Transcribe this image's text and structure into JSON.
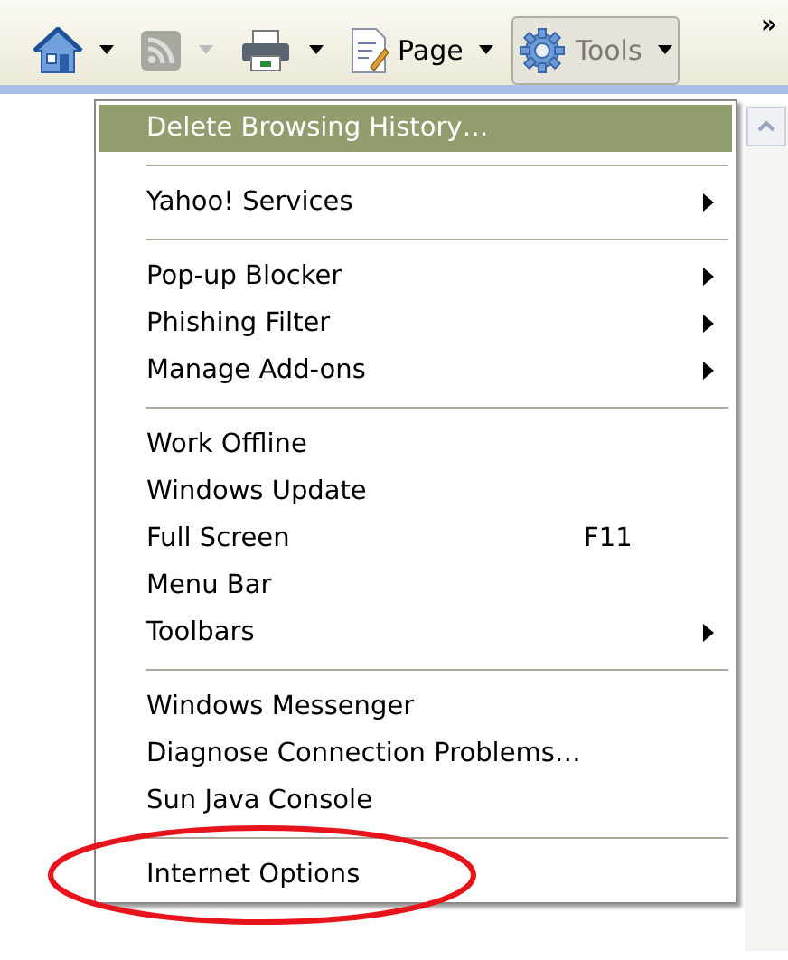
{
  "toolbar": {
    "buttons": [
      {
        "kind": "home",
        "dropdown": true,
        "disabled": false,
        "pressed": false
      },
      {
        "kind": "feeds",
        "dropdown": true,
        "disabled": true,
        "pressed": false
      },
      {
        "kind": "print",
        "dropdown": true,
        "disabled": false,
        "pressed": false
      },
      {
        "kind": "page",
        "label": "Page",
        "dropdown": true,
        "disabled": false,
        "pressed": false
      },
      {
        "kind": "tools",
        "label": "Tools",
        "dropdown": true,
        "disabled": false,
        "pressed": true
      }
    ],
    "overflow": "»"
  },
  "menu": {
    "groups": [
      [
        {
          "label": "Delete Browsing History…",
          "selected": true,
          "submenu": false,
          "circled": false
        }
      ],
      [
        {
          "label": "Yahoo! Services",
          "selected": false,
          "submenu": true,
          "circled": false
        }
      ],
      [
        {
          "label": "Pop-up Blocker",
          "selected": false,
          "submenu": true,
          "circled": false
        },
        {
          "label": "Phishing Filter",
          "selected": false,
          "submenu": true,
          "circled": false
        },
        {
          "label": "Manage Add-ons",
          "selected": false,
          "submenu": true,
          "circled": false
        }
      ],
      [
        {
          "label": "Work Offline",
          "selected": false,
          "submenu": false,
          "circled": false
        },
        {
          "label": "Windows Update",
          "selected": false,
          "submenu": false,
          "circled": false
        },
        {
          "label": "Full Screen",
          "shortcut": "F11",
          "selected": false,
          "submenu": false,
          "circled": false
        },
        {
          "label": "Menu Bar",
          "selected": false,
          "submenu": false,
          "circled": false
        },
        {
          "label": "Toolbars",
          "selected": false,
          "submenu": true,
          "circled": false
        }
      ],
      [
        {
          "label": "Windows Messenger",
          "selected": false,
          "submenu": false,
          "circled": false
        },
        {
          "label": "Diagnose Connection Problems…",
          "selected": false,
          "submenu": false,
          "circled": false
        },
        {
          "label": "Sun Java Console",
          "selected": false,
          "submenu": false,
          "circled": false
        }
      ],
      [
        {
          "label": "Internet Options",
          "selected": false,
          "submenu": false,
          "circled": true
        }
      ]
    ]
  }
}
